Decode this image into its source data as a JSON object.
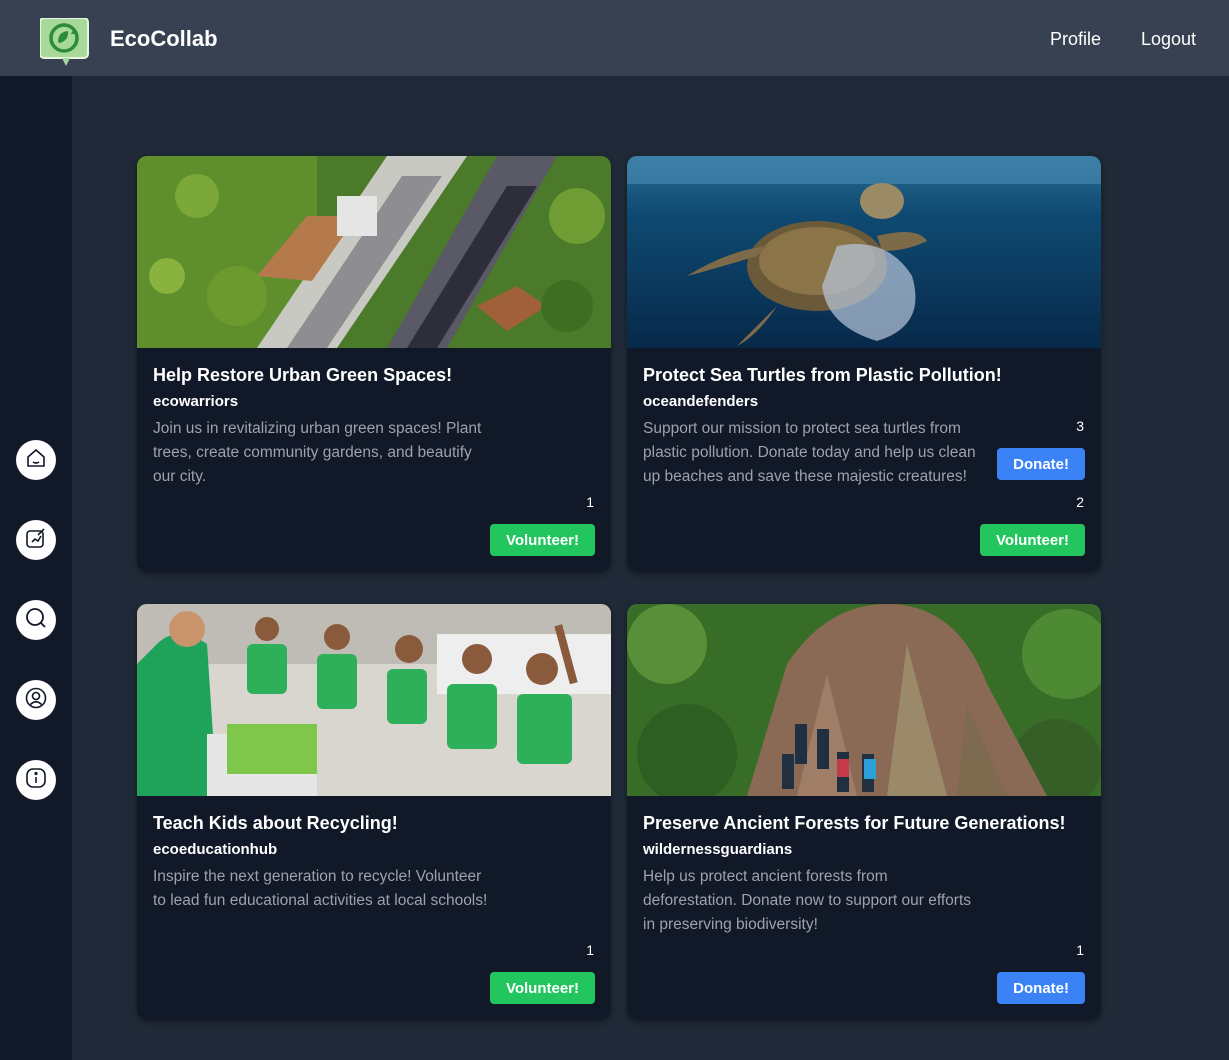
{
  "header": {
    "brand": "EcoCollab",
    "nav": {
      "profile": "Profile",
      "logout": "Logout"
    }
  },
  "sidebar": {
    "items": [
      {
        "icon": "home-icon"
      },
      {
        "icon": "create-post-icon"
      },
      {
        "icon": "search-icon"
      },
      {
        "icon": "user-icon"
      },
      {
        "icon": "info-icon"
      }
    ]
  },
  "colors": {
    "volunteer": "#22c55e",
    "donate": "#3b82f6",
    "background": "#1f2937",
    "card": "#111827"
  },
  "posts": [
    {
      "title": "Help Restore Urban Green Spaces!",
      "user": "ecowarriors",
      "description": "Join us in revitalizing urban green spaces! Plant trees, create community gardens, and beautify our city.",
      "volunteer_count": "1",
      "volunteer_label": "Volunteer!"
    },
    {
      "title": "Protect Sea Turtles from Plastic Pollution!",
      "user": "oceandefenders",
      "description": "Support our mission to protect sea turtles from plastic pollution. Donate today and help us clean up beaches and save these majestic creatures!",
      "donate_count": "3",
      "donate_label": "Donate!",
      "volunteer_count": "2",
      "volunteer_label": "Volunteer!"
    },
    {
      "title": "Teach Kids about Recycling!",
      "user": "ecoeducationhub",
      "description": "Inspire the next generation to recycle! Volunteer to lead fun educational activities at local schools!",
      "volunteer_count": "1",
      "volunteer_label": "Volunteer!"
    },
    {
      "title": "Preserve Ancient Forests for Future Generations!",
      "user": "wildernessguardians",
      "description": "Help us protect ancient forests from deforestation. Donate now to support our efforts in preserving biodiversity!",
      "donate_count": "1",
      "donate_label": "Donate!"
    }
  ]
}
